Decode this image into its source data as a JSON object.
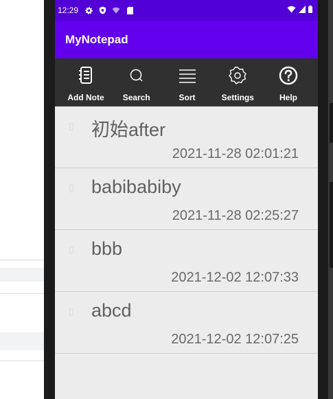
{
  "status_bar": {
    "time": "12:29"
  },
  "app": {
    "title": "MyNotepad"
  },
  "toolbar": {
    "items": [
      {
        "label": "Add Note",
        "icon": "notebook-icon"
      },
      {
        "label": "Search",
        "icon": "search-icon"
      },
      {
        "label": "Sort",
        "icon": "sort-lines-icon"
      },
      {
        "label": "Settings",
        "icon": "gear-icon"
      },
      {
        "label": "Help",
        "icon": "question-circle-icon"
      }
    ]
  },
  "notes": [
    {
      "title": "初始after",
      "timestamp": "2021-11-28 02:01:21"
    },
    {
      "title": "babibabiby",
      "timestamp": "2021-11-28 02:25:27"
    },
    {
      "title": "bbb",
      "timestamp": "2021-12-02 12:07:33"
    },
    {
      "title": "abcd",
      "timestamp": "2021-12-02 12:07:25"
    }
  ],
  "colors": {
    "status_bar": "#5200d6",
    "app_bar": "#6200ee",
    "toolbar": "#303030",
    "list_background": "#ececec"
  }
}
